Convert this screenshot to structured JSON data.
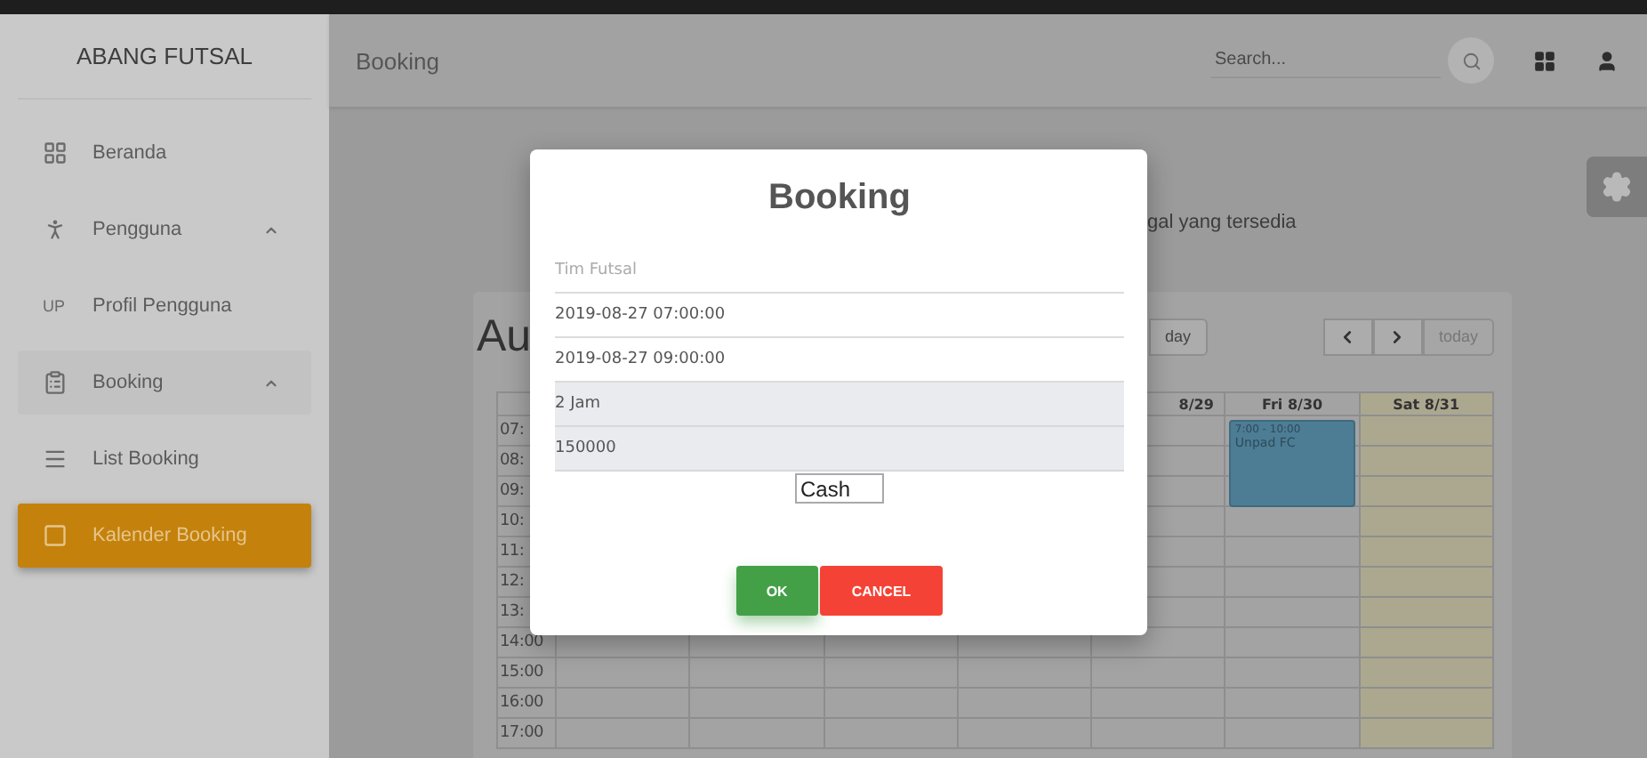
{
  "sidebar": {
    "title": "ABANG FUTSAL",
    "items": [
      {
        "label": "Beranda",
        "selected": false
      },
      {
        "label": "Pengguna",
        "selected": false,
        "expanded": true,
        "children": [
          {
            "label": "Profil Pengguna",
            "abbr": "UP",
            "selected": false
          }
        ]
      },
      {
        "label": "Booking",
        "selected": false,
        "expanded": true,
        "children": [
          {
            "label": "List Booking",
            "selected": false
          },
          {
            "label": "Kalender Booking",
            "selected": true
          }
        ]
      }
    ]
  },
  "header": {
    "title": "Booking",
    "search": {
      "placeholder": "Search..."
    }
  },
  "page": {
    "subtitle": "gal yang tersedia"
  },
  "calendar": {
    "title": "Au",
    "view_buttons": [
      {
        "label": "day",
        "selected": false
      }
    ],
    "today_button": "today",
    "days": [
      {
        "today": false
      },
      {
        "today": false
      },
      {
        "today": false
      },
      {
        "today": false
      },
      {
        "label": "8/29",
        "today": false
      },
      {
        "label": "Fri 8/30",
        "today": false,
        "events": [
          {
            "time": "7:00 - 10:00",
            "title": "Unpad FC"
          }
        ]
      },
      {
        "label": "Sat 8/31",
        "today": true
      }
    ],
    "times": [
      "07:",
      "08:",
      "09:",
      "10:",
      "11:",
      "12:",
      "13:",
      "14:00",
      "15:00",
      "16:00",
      "17:00"
    ]
  },
  "modal": {
    "title": "Booking",
    "fields": [
      {
        "kind": "input",
        "placeholder": "Tim Futsal",
        "readonly": false
      },
      {
        "kind": "input",
        "value": "2019-08-27 07:00:00",
        "readonly": false
      },
      {
        "kind": "input",
        "value": "2019-08-27 09:00:00",
        "readonly": false
      },
      {
        "kind": "input",
        "value": "2 Jam",
        "readonly": true
      },
      {
        "kind": "input",
        "value": "150000",
        "readonly": true
      },
      {
        "kind": "select",
        "value": "Cash"
      }
    ],
    "buttons": [
      {
        "label": "OK",
        "kind": "confirm"
      },
      {
        "label": "CANCEL",
        "kind": "cancel"
      }
    ]
  }
}
